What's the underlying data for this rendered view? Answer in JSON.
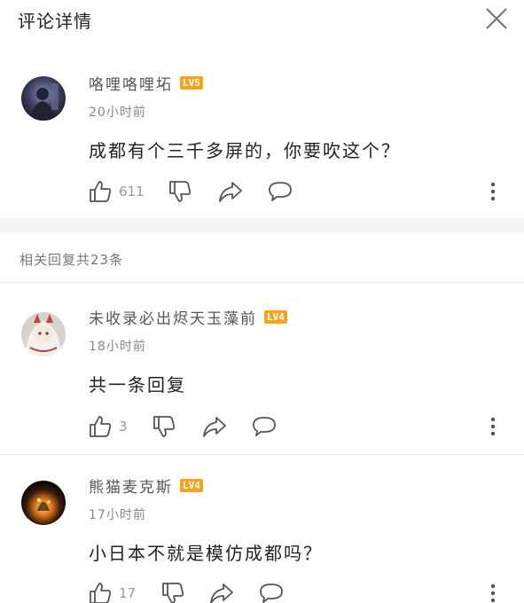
{
  "header": {
    "title": "评论详情"
  },
  "main_comment": {
    "username": "咯哩咯哩坧",
    "level": "LV5",
    "time": "20小时前",
    "content": "成都有个三千多屏的，你要吹这个？",
    "likes": "611"
  },
  "replies_header": "相关回复共23条",
  "replies": [
    {
      "username": "未收录必出烬天玉藻前",
      "level": "LV4",
      "time": "18小时前",
      "content": "共一条回复",
      "likes": "3"
    },
    {
      "username": "熊猫麦克斯",
      "level": "LV4",
      "time": "17小时前",
      "content": "小日本不就是模仿成都吗？",
      "likes": "17"
    }
  ],
  "colors": {
    "level_badge": "#f6a31f",
    "icon": "#555555",
    "separator": "#f4f4f4"
  }
}
